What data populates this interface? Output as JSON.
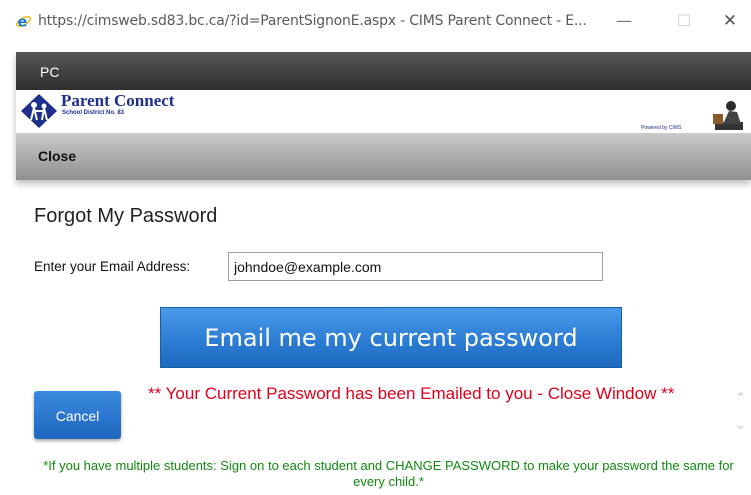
{
  "window": {
    "title": "https://cimsweb.sd83.bc.ca/?id=ParentSignonE.aspx - CIMS Parent Connect - E...",
    "minimize_glyph": "—",
    "maximize_glyph": "☐",
    "close_glyph": "✕",
    "icon": "ie-browser-icon"
  },
  "header": {
    "pc_label": "PC",
    "brand_title": "Parent Connect",
    "brand_subtitle": "School District No. 83",
    "powered_by": "Powered by CIMS",
    "close_label": "Close"
  },
  "form": {
    "heading": "Forgot My Password",
    "email_label": "Enter your Email Address:",
    "email_value": "johndoe@example.com",
    "submit_label": "Email me my current password",
    "cancel_label": "Cancel",
    "status_message": "** Your Current Password has been Emailed to you - Close Window **",
    "note": "*If you have multiple students: Sign on to each student and CHANGE PASSWORD to make your password the same for every child.*"
  },
  "colors": {
    "brand": "#1f2f8c",
    "button_blue": "#2e7fd6",
    "status_red": "#e0001b",
    "note_green": "#118a11"
  }
}
